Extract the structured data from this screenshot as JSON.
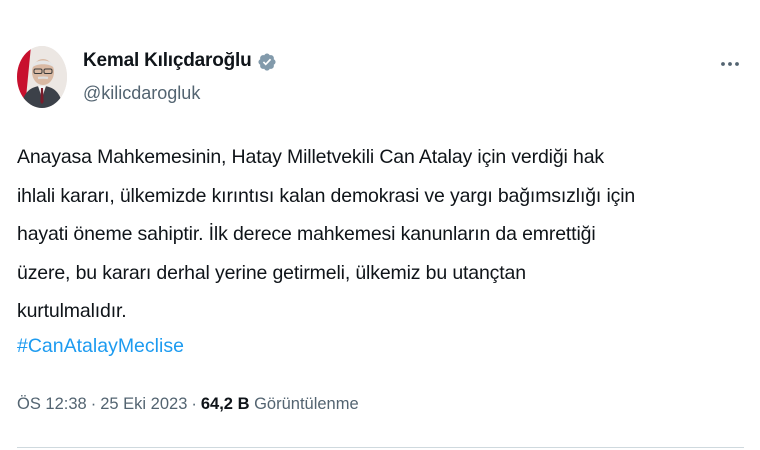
{
  "author": {
    "name": "Kemal Kılıçdaroğlu",
    "handle": "@kilicdarogluk",
    "verified_color": "#829aab"
  },
  "tweet": {
    "lines": [
      "Anayasa Mahkemesinin, Hatay Milletvekili Can Atalay için verdiği hak",
      "ihlali kararı, ülkemizde kırıntısı kalan demokrasi ve yargı bağımsızlığı için",
      "hayati öneme sahiptir. İlk derece mahkemesi kanunların da emrettiği",
      "üzere, bu kararı derhal yerine getirmeli, ülkemiz bu utançtan",
      "kurtulmalıdır."
    ],
    "hashtag": "#CanAtalayMeclise"
  },
  "meta": {
    "time": "ÖS 12:38",
    "separator": "·",
    "date": "25 Eki 2023",
    "views_count": "64,2 B",
    "views_label": "Görüntülenme"
  },
  "colors": {
    "text": "#0f1419",
    "secondary": "#536471",
    "link": "#1d9bf0",
    "divider": "#cfd9de"
  },
  "icons": {
    "verified": "verified-badge-icon",
    "more": "more-options-icon"
  }
}
